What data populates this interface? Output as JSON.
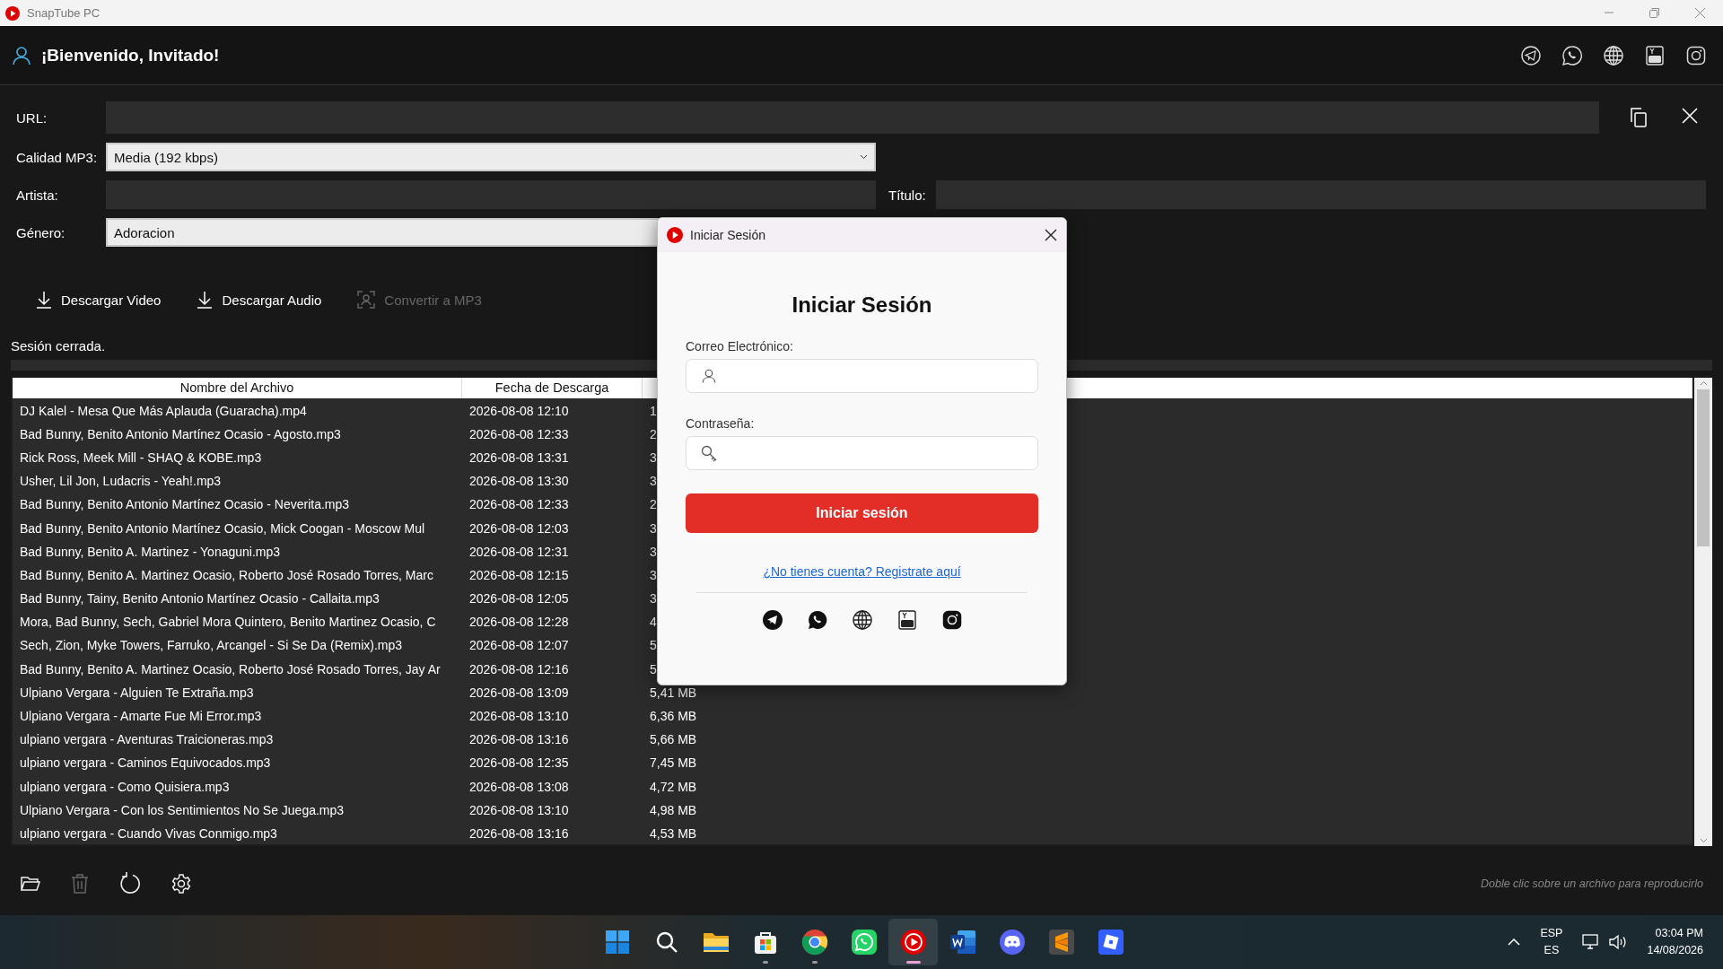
{
  "window": {
    "title": "SnapTube PC"
  },
  "header": {
    "greeting": "¡Bienvenido, Invitado!"
  },
  "form": {
    "url_label": "URL:",
    "quality_label": "Calidad MP3:",
    "quality_value": "Media (192 kbps)",
    "artist_label": "Artista:",
    "title_label": "Título:",
    "genre_label": "Género:",
    "genre_value": "Adoracion"
  },
  "actions": [
    {
      "kind": "download",
      "label": "Descargar Video",
      "disabled": false
    },
    {
      "kind": "download",
      "label": "Descargar Audio",
      "disabled": false
    },
    {
      "kind": "convert",
      "label": "Convertir a MP3",
      "disabled": true
    }
  ],
  "status": "Sesión cerrada.",
  "progress": {
    "level": 0
  },
  "table": {
    "columns": [
      "Nombre del Archivo",
      "Fecha de Descarga"
    ],
    "rows": [
      {
        "name": "DJ Kalel - Mesa Que Más Aplauda (Guaracha).mp4",
        "date": "2026-08-08 12:10",
        "size": "1"
      },
      {
        "name": "Bad Bunny, Benito Antonio Martínez Ocasio - Agosto.mp3",
        "date": "2026-08-08 12:33",
        "size": "2"
      },
      {
        "name": "Rick Ross, Meek Mill - SHAQ & KOBE.mp3",
        "date": "2026-08-08 13:31",
        "size": "3"
      },
      {
        "name": "Usher, Lil Jon, Ludacris - Yeah!.mp3",
        "date": "2026-08-08 13:30",
        "size": "3"
      },
      {
        "name": "Bad Bunny, Benito Antonio Martínez Ocasio - Neverita.mp3",
        "date": "2026-08-08 12:33",
        "size": "2"
      },
      {
        "name": "Bad Bunny, Benito Antonio Martínez Ocasio, Mick Coogan - Moscow Mul",
        "date": "2026-08-08 12:03",
        "size": "3"
      },
      {
        "name": "Bad Bunny, Benito A. Martinez - Yonaguni.mp3",
        "date": "2026-08-08 12:31",
        "size": "3"
      },
      {
        "name": "Bad Bunny, Benito A. Martinez Ocasio, Roberto José Rosado Torres, Marc",
        "date": "2026-08-08 12:15",
        "size": "3"
      },
      {
        "name": "Bad Bunny, Tainy, Benito Antonio Martínez Ocasio - Callaita.mp3",
        "date": "2026-08-08 12:05",
        "size": "3"
      },
      {
        "name": "Mora, Bad Bunny, Sech, Gabriel Mora Quintero, Benito Martinez Ocasio, C",
        "date": "2026-08-08 12:28",
        "size": "4"
      },
      {
        "name": "Sech, Zion, Myke Towers, Farruko, Arcangel - Si Se Da (Remix).mp3",
        "date": "2026-08-08 12:07",
        "size": "5"
      },
      {
        "name": "Bad Bunny, Benito A. Martinez Ocasio, Roberto José Rosado Torres, Jay Ar",
        "date": "2026-08-08 12:16",
        "size": "5"
      },
      {
        "name": "Ulpiano Vergara - Alguien Te Extraña.mp3",
        "date": "2026-08-08 13:09",
        "size": "5,41 MB"
      },
      {
        "name": "Ulpiano Vergara - Amarte Fue Mi Error.mp3",
        "date": "2026-08-08 13:10",
        "size": "6,36 MB"
      },
      {
        "name": "ulpiano vergara - Aventuras Traicioneras.mp3",
        "date": "2026-08-08 13:16",
        "size": "5,66 MB"
      },
      {
        "name": "ulpiano vergara - Caminos Equivocados.mp3",
        "date": "2026-08-08 12:35",
        "size": "7,45 MB"
      },
      {
        "name": "ulpiano vergara - Como Quisiera.mp3",
        "date": "2026-08-08 13:08",
        "size": "4,72 MB"
      },
      {
        "name": "Ulpiano Vergara - Con los Sentimientos No Se Juega.mp3",
        "date": "2026-08-08 13:10",
        "size": "4,98 MB"
      },
      {
        "name": "ulpiano vergara - Cuando Vivas Conmigo.mp3",
        "date": "2026-08-08 13:16",
        "size": "4,53 MB"
      }
    ]
  },
  "toolbar": [
    {
      "kind": "folder",
      "disabled": false
    },
    {
      "kind": "trash",
      "disabled": true
    },
    {
      "kind": "refresh",
      "disabled": false
    },
    {
      "kind": "settings",
      "disabled": false
    }
  ],
  "footer_hint": "Doble clic sobre un archivo para reproducirlo",
  "dialog": {
    "title": "Iniciar Sesión",
    "heading": "Iniciar Sesión",
    "email_label": "Correo Electrónico:",
    "password_label": "Contraseña:",
    "submit": "Iniciar sesión",
    "register_link": "¿No tienes cuenta? Registrate aquí"
  },
  "taskbar": {
    "apps": [
      {
        "kind": "start",
        "running": false,
        "active": false
      },
      {
        "kind": "search",
        "running": false,
        "active": false
      },
      {
        "kind": "folder",
        "running": false,
        "active": false
      },
      {
        "kind": "store",
        "running": true,
        "active": false
      },
      {
        "kind": "browser",
        "running": true,
        "active": false
      },
      {
        "kind": "chat",
        "running": false,
        "active": false
      },
      {
        "kind": "player",
        "running": true,
        "active": true
      },
      {
        "kind": "document",
        "running": false,
        "active": false
      },
      {
        "kind": "voice",
        "running": false,
        "active": false
      },
      {
        "kind": "editor",
        "running": false,
        "active": false
      },
      {
        "kind": "game",
        "running": false,
        "active": false
      }
    ],
    "language": "ESP",
    "layout": "ES",
    "time": "03:04 PM",
    "date": "14/08/2026"
  }
}
